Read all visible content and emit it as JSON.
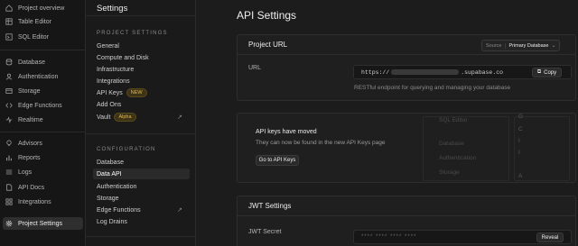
{
  "nav": {
    "items": [
      {
        "label": "Project overview",
        "icon": "home-icon"
      },
      {
        "label": "Table Editor",
        "icon": "table-icon"
      },
      {
        "label": "SQL Editor",
        "icon": "terminal-icon"
      },
      {
        "label": "Database",
        "icon": "database-icon"
      },
      {
        "label": "Authentication",
        "icon": "users-icon"
      },
      {
        "label": "Storage",
        "icon": "archive-icon"
      },
      {
        "label": "Edge Functions",
        "icon": "code-icon"
      },
      {
        "label": "Realtime",
        "icon": "realtime-icon"
      },
      {
        "label": "Advisors",
        "icon": "lightbulb-icon"
      },
      {
        "label": "Reports",
        "icon": "chart-icon"
      },
      {
        "label": "Logs",
        "icon": "list-icon"
      },
      {
        "label": "API Docs",
        "icon": "file-icon"
      },
      {
        "label": "Integrations",
        "icon": "grid-icon"
      },
      {
        "label": "Project Settings",
        "icon": "gear-icon"
      }
    ]
  },
  "sidebar": {
    "title": "Settings",
    "project_heading": "PROJECT SETTINGS",
    "project_items": [
      {
        "label": "General"
      },
      {
        "label": "Compute and Disk"
      },
      {
        "label": "Infrastructure"
      },
      {
        "label": "Integrations"
      },
      {
        "label": "API Keys",
        "badge": "NEW"
      },
      {
        "label": "Add Ons"
      },
      {
        "label": "Vault",
        "badge": "Alpha"
      }
    ],
    "config_heading": "CONFIGURATION",
    "config_items": [
      {
        "label": "Database"
      },
      {
        "label": "Data API"
      },
      {
        "label": "Authentication"
      },
      {
        "label": "Storage"
      },
      {
        "label": "Edge Functions"
      },
      {
        "label": "Log Drains"
      }
    ]
  },
  "main": {
    "title": "API Settings",
    "project_url": {
      "heading": "Project URL",
      "source_label": "Source",
      "source_value": "Primary Database",
      "url_label": "URL",
      "url_prefix": "https://",
      "url_suffix": ".supabase.co",
      "copy_label": "Copy",
      "help": "RESTful endpoint for querying and managing your database"
    },
    "api_keys_moved": {
      "title": "API keys have moved",
      "subtitle": "They can now be found in the new API Keys page",
      "button": "Go to API Keys",
      "ghost_items": [
        "SQL Editor",
        "Database",
        "Authentication",
        "Storage"
      ]
    },
    "jwt": {
      "heading": "JWT Settings",
      "secret_label": "JWT Secret",
      "secret_mask": "**** **** **** ****",
      "reveal_label": "Reveal"
    }
  },
  "colors": {
    "background": "#1c1c1c",
    "badge_text": "#e9b949",
    "active_item": "#2e2e2e"
  }
}
